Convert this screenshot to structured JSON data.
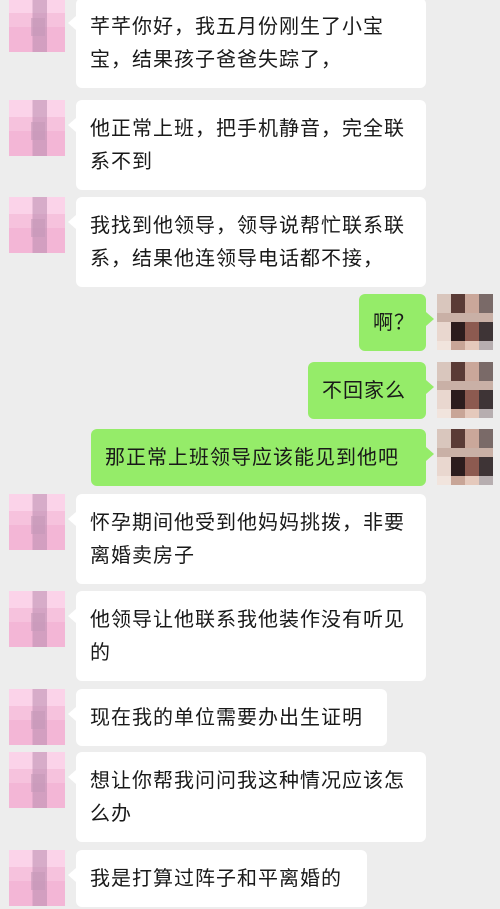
{
  "chat": {
    "messages": [
      {
        "side": "in",
        "text": "芊芊你好，我五月份刚生了小宝宝，结果孩子爸爸失踪了，"
      },
      {
        "side": "in",
        "text": "他正常上班，把手机静音，完全联系不到"
      },
      {
        "side": "in",
        "text": "我找到他领导，领导说帮忙联系联系，结果他连领导电话都不接，"
      },
      {
        "side": "out",
        "text": "啊？"
      },
      {
        "side": "out",
        "text": "不回家么"
      },
      {
        "side": "out",
        "text": "那正常上班领导应该能见到他吧"
      },
      {
        "side": "in",
        "text": "怀孕期间他受到他妈妈挑拨，非要离婚卖房子"
      },
      {
        "side": "in",
        "text": "他领导让他联系我他装作没有听见的"
      },
      {
        "side": "in",
        "text": "现在我的单位需要办出生证明"
      },
      {
        "side": "in",
        "text": "想让你帮我问问我这种情况应该怎么办"
      },
      {
        "side": "in",
        "text": "我是打算过阵子和平离婚的"
      }
    ]
  },
  "colors": {
    "background": "#ededed",
    "incoming_bubble": "#ffffff",
    "outgoing_bubble": "#95ec69",
    "text": "#191919"
  },
  "icons": {
    "incoming_avatar": "pixelated-pink-avatar-icon",
    "outgoing_avatar": "pixelated-photo-avatar-icon"
  }
}
